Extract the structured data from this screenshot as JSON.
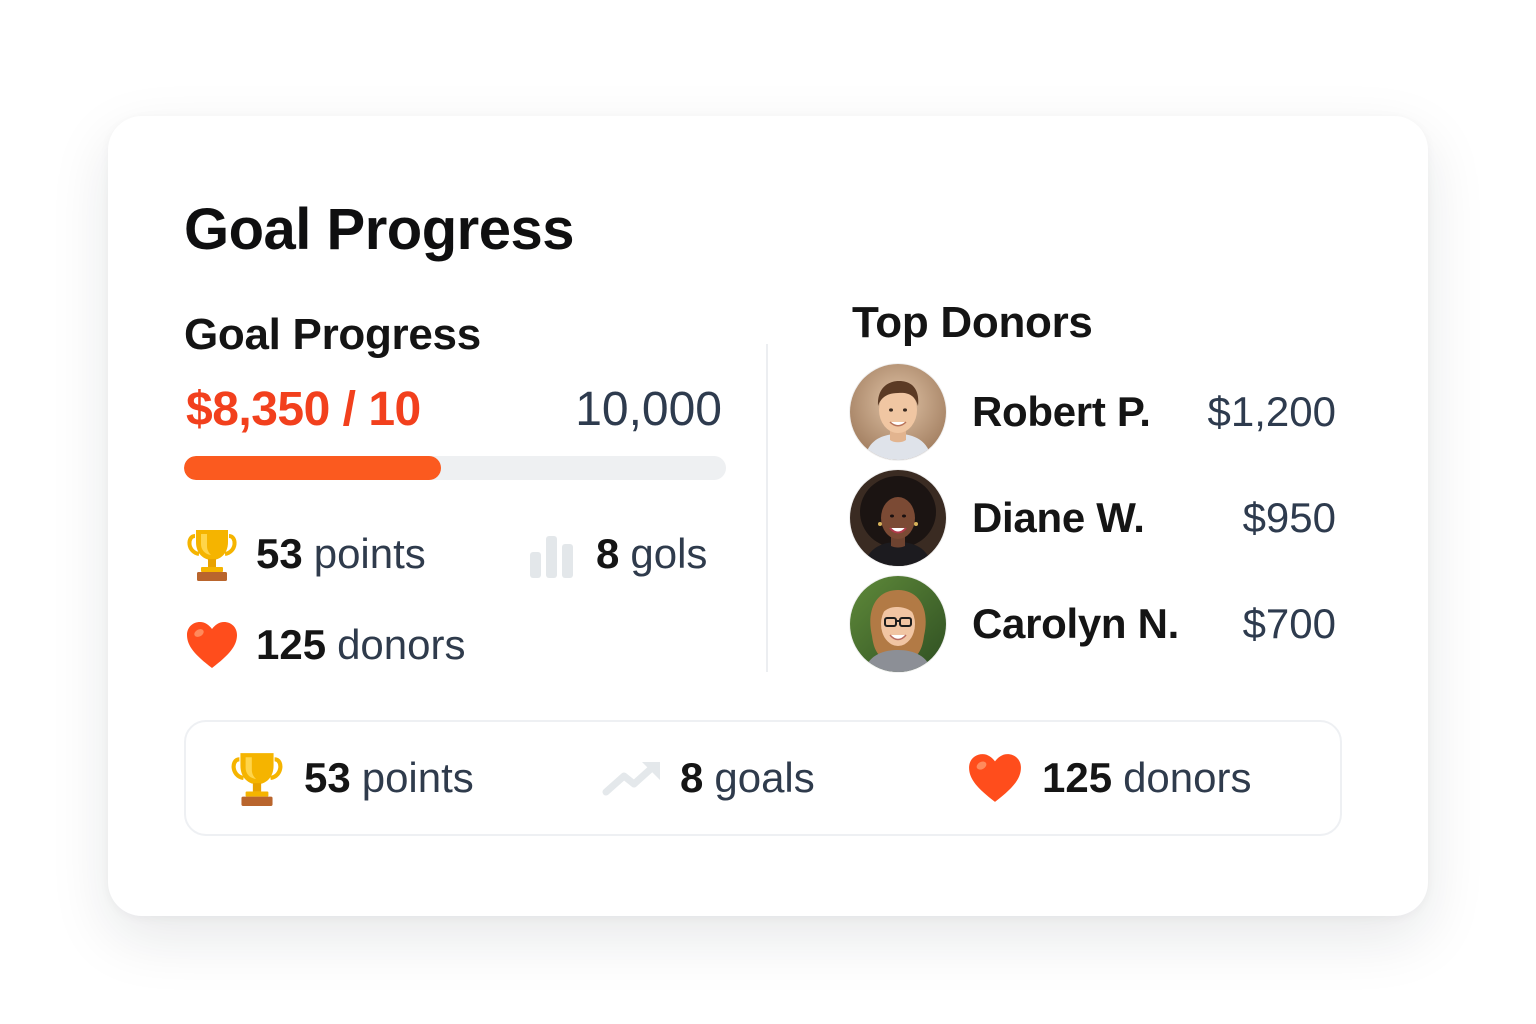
{
  "card": {
    "title": "Goal Progress"
  },
  "goal": {
    "section_title": "Goal Progress",
    "raised_label": "$8,350 / 10",
    "target_label": "10,000",
    "progress_fraction": 0.475,
    "progress_color": "#fb5a1f"
  },
  "stats": {
    "points": {
      "value": "53",
      "unit": "points",
      "icon": "trophy-icon"
    },
    "goals": {
      "value": "8",
      "unit": "gols",
      "icon": "bar-chart-icon"
    },
    "donors": {
      "value": "125",
      "unit": "donors",
      "icon": "heart-icon"
    }
  },
  "top_donors": {
    "section_title": "Top Donors",
    "donors": [
      {
        "name": "Robert P.",
        "amount": "$1,200"
      },
      {
        "name": "Diane W.",
        "amount": "$950"
      },
      {
        "name": "Carolyn N.",
        "amount": "$700"
      }
    ]
  },
  "summary": {
    "points": {
      "value": "53",
      "unit": "points",
      "icon": "trophy-icon"
    },
    "goals": {
      "value": "8",
      "unit": "goals",
      "icon": "trending-up-icon"
    },
    "donors": {
      "value": "125",
      "unit": "donors",
      "icon": "heart-icon"
    }
  },
  "colors": {
    "accent": "#f2401d",
    "heart": "#ff4d1c",
    "trophy": "#f5b400",
    "text_muted": "#2f3b4c"
  }
}
